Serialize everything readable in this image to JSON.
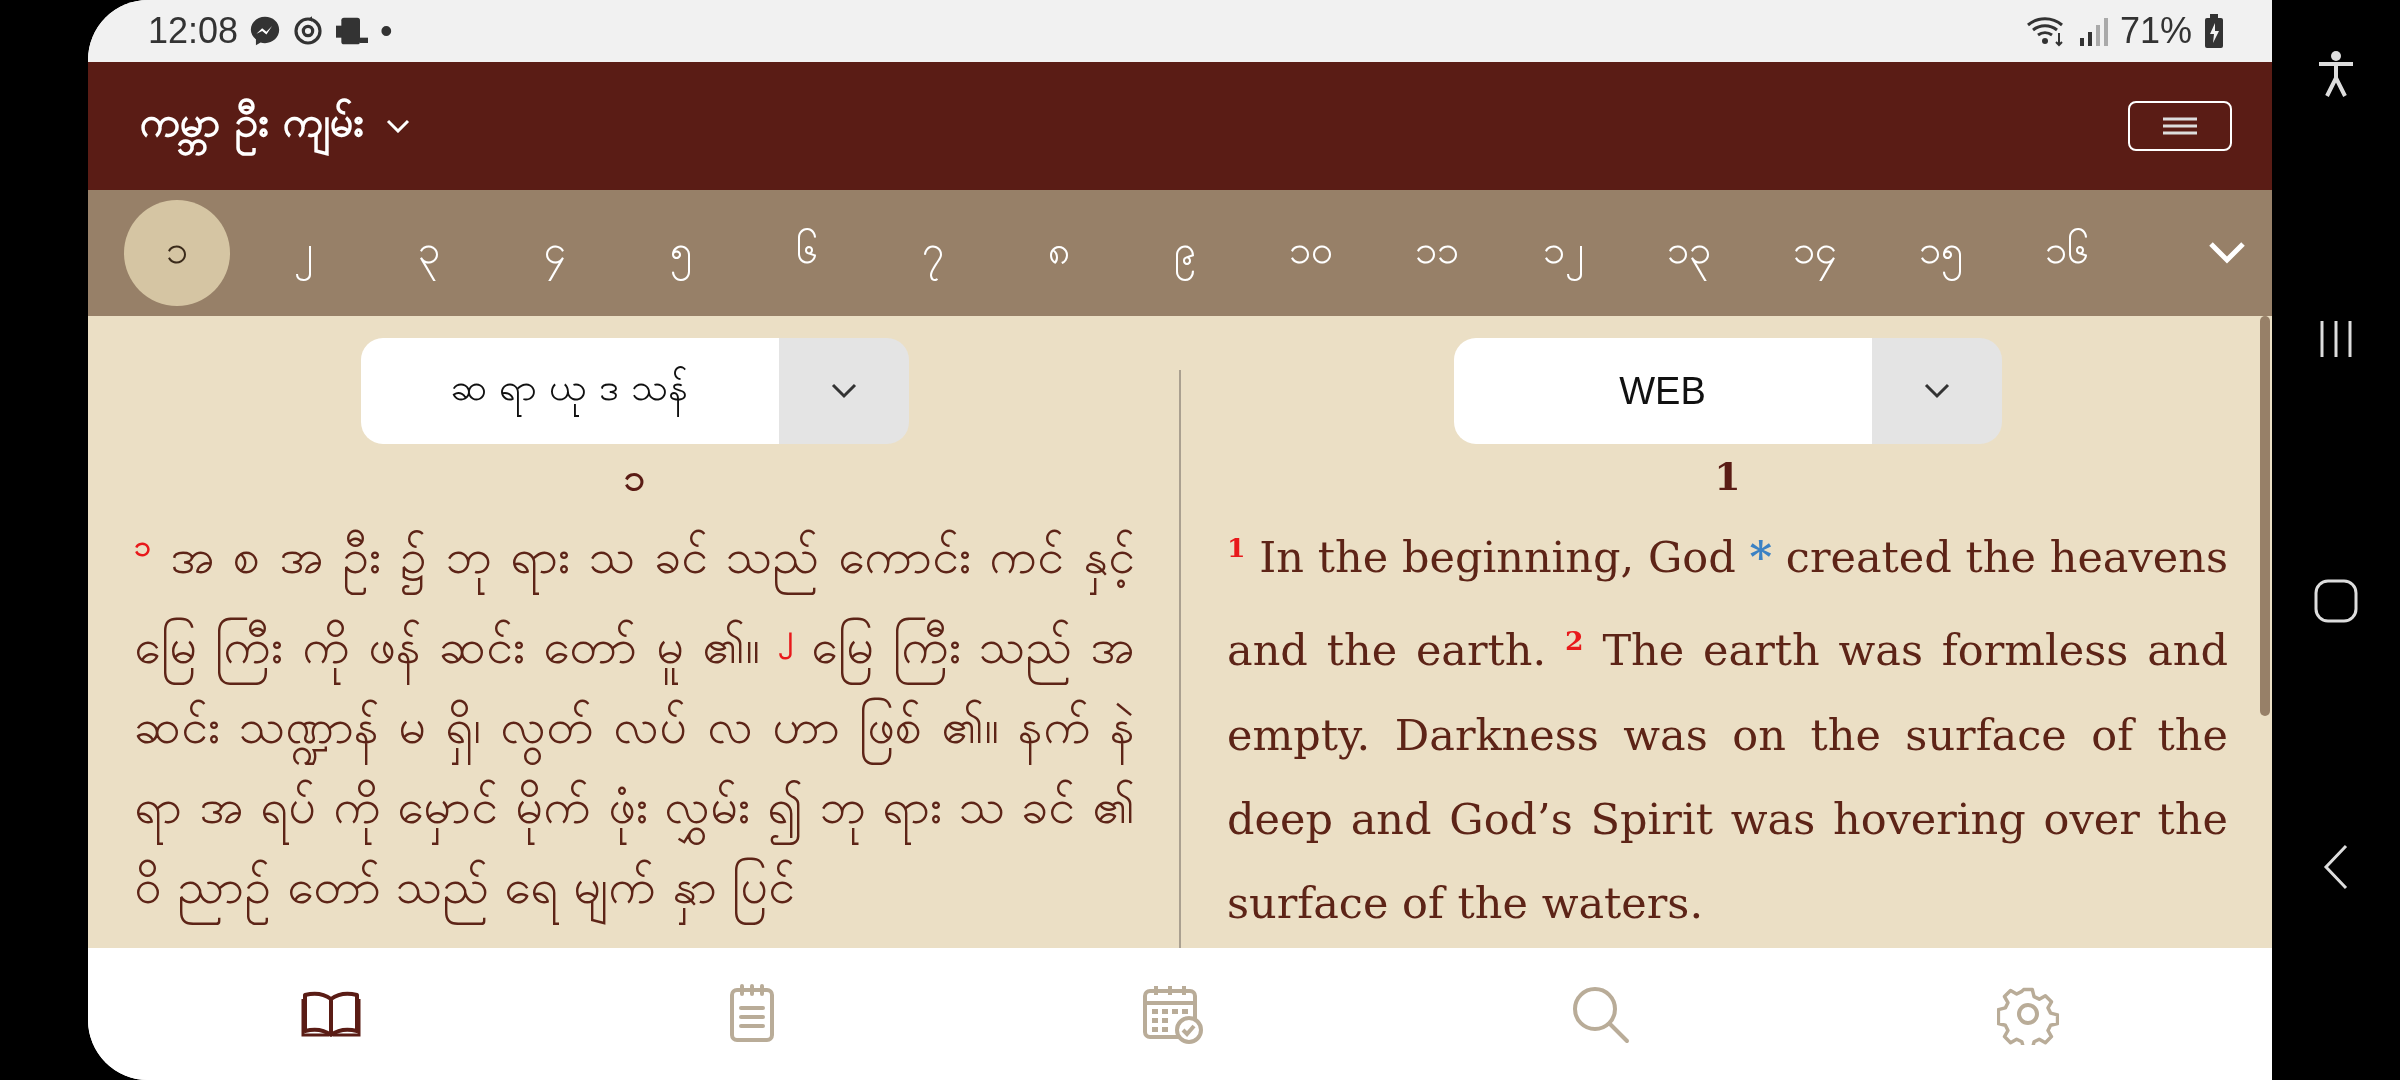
{
  "status_bar": {
    "time": "12:08",
    "dot": "•",
    "battery": "71%"
  },
  "header": {
    "title": "ကမ္ဘာ ဦး ကျမ်း"
  },
  "chapters": [
    {
      "label": "၁",
      "selected": true
    },
    {
      "label": "၂",
      "selected": false
    },
    {
      "label": "၃",
      "selected": false
    },
    {
      "label": "၄",
      "selected": false
    },
    {
      "label": "၅",
      "selected": false
    },
    {
      "label": "၆",
      "selected": false
    },
    {
      "label": "၇",
      "selected": false
    },
    {
      "label": "၈",
      "selected": false
    },
    {
      "label": "၉",
      "selected": false
    },
    {
      "label": "၁၀",
      "selected": false
    },
    {
      "label": "၁၁",
      "selected": false
    },
    {
      "label": "၁၂",
      "selected": false
    },
    {
      "label": "၁၃",
      "selected": false
    },
    {
      "label": "၁၄",
      "selected": false
    },
    {
      "label": "၁၅",
      "selected": false
    },
    {
      "label": "၁၆",
      "selected": false
    }
  ],
  "panels": [
    {
      "version": "ဆ ရာ ယု ဒ သန်",
      "chapter": "၁",
      "verses": [
        {
          "number": "၁",
          "parts": [
            {
              "kind": "text",
              "text": "အ စ အ ဦး ၌ ဘု ရား သ ခင် သည် ကောင်း ကင် နှင့် မြေ ကြီး ကို ဖန် ဆင်း တော် မူ ၏။"
            }
          ]
        },
        {
          "number": "၂",
          "parts": [
            {
              "kind": "text",
              "text": "မြေ ကြီး သည် အ ဆင်း သဏ္ဍာန် မ ရှိ၊ လွတ် လပ် လ ဟာ ဖြစ် ၏။ နက် နဲ ရာ အ ရပ် ကို မှောင် မိုက် ဖုံး လွှမ်း ၍ ဘု ရား သ ခင် ၏ ဝိ ညာဉ် တော် သည် ရေ မျက် နှာ ပြင်"
            }
          ]
        }
      ]
    },
    {
      "version": "WEB",
      "chapter": "1",
      "verses": [
        {
          "number": "1",
          "parts": [
            {
              "kind": "text",
              "text": "In the beginning, God"
            },
            {
              "kind": "footnote",
              "text": "*"
            },
            {
              "kind": "text",
              "text": "created the heavens and the earth."
            }
          ]
        },
        {
          "number": "2",
          "parts": [
            {
              "kind": "text",
              "text": "The earth was formless and empty. Darkness was on the surface of the deep and God’s Spirit was hovering over the surface of the waters."
            }
          ]
        }
      ]
    }
  ],
  "bottom_nav": [
    {
      "selected": true
    },
    {
      "selected": false
    },
    {
      "selected": false
    },
    {
      "selected": false
    },
    {
      "selected": false
    }
  ]
}
